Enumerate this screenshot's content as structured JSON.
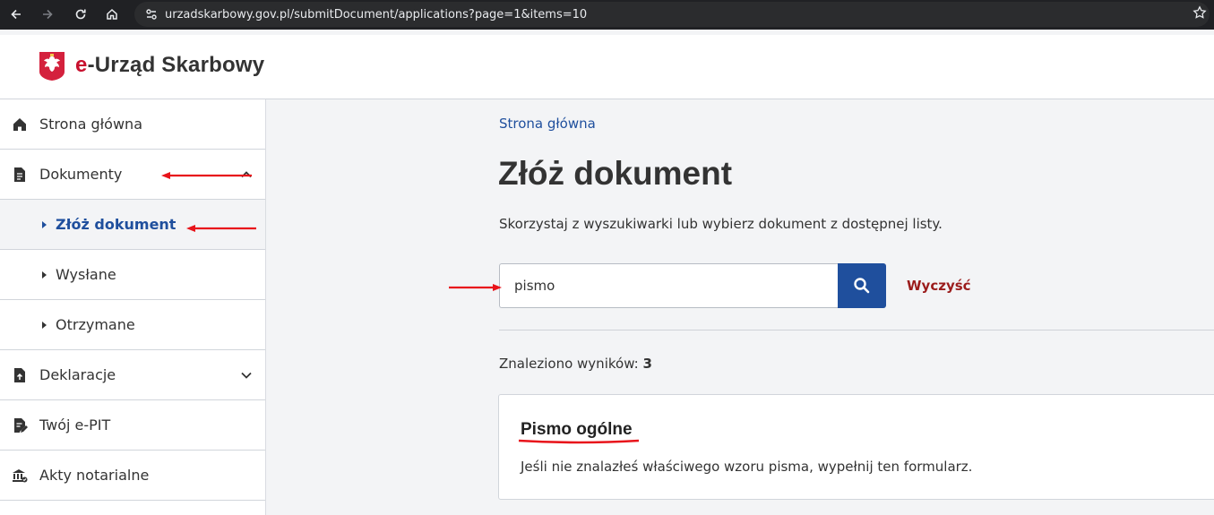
{
  "browser": {
    "url": "urzadskarbowy.gov.pl/submitDocument/applications?page=1&items=10"
  },
  "header": {
    "logo_prefix": "e",
    "logo_rest": "-Urząd Skarbowy"
  },
  "sidebar": {
    "items": [
      {
        "label": "Strona główna",
        "icon": "home-icon"
      },
      {
        "label": "Dokumenty",
        "icon": "document-icon"
      },
      {
        "label": "Złóż dokument"
      },
      {
        "label": "Wysłane"
      },
      {
        "label": "Otrzymane"
      },
      {
        "label": "Deklaracje",
        "icon": "document-upload-icon"
      },
      {
        "label": "Twój e-PIT",
        "icon": "document-edit-icon"
      },
      {
        "label": "Akty notarialne",
        "icon": "notary-icon"
      }
    ]
  },
  "main": {
    "breadcrumb": "Strona główna",
    "title": "Złóż dokument",
    "description": "Skorzystaj z wyszukiwarki lub wybierz dokument z dostępnej listy.",
    "search": {
      "value": "pismo"
    },
    "clear_label": "Wyczyść",
    "results_label": "Znaleziono wyników:",
    "results_count": "3",
    "results": [
      {
        "title": "Pismo ogólne",
        "description": "Jeśli nie znalazłeś właściwego wzoru pisma, wypełnij ten formularz."
      }
    ]
  },
  "colors": {
    "brand_blue": "#1f4f9d",
    "brand_red": "#c8102e",
    "clear_red": "#9b1c1c",
    "annotation_red": "#e8141b"
  }
}
